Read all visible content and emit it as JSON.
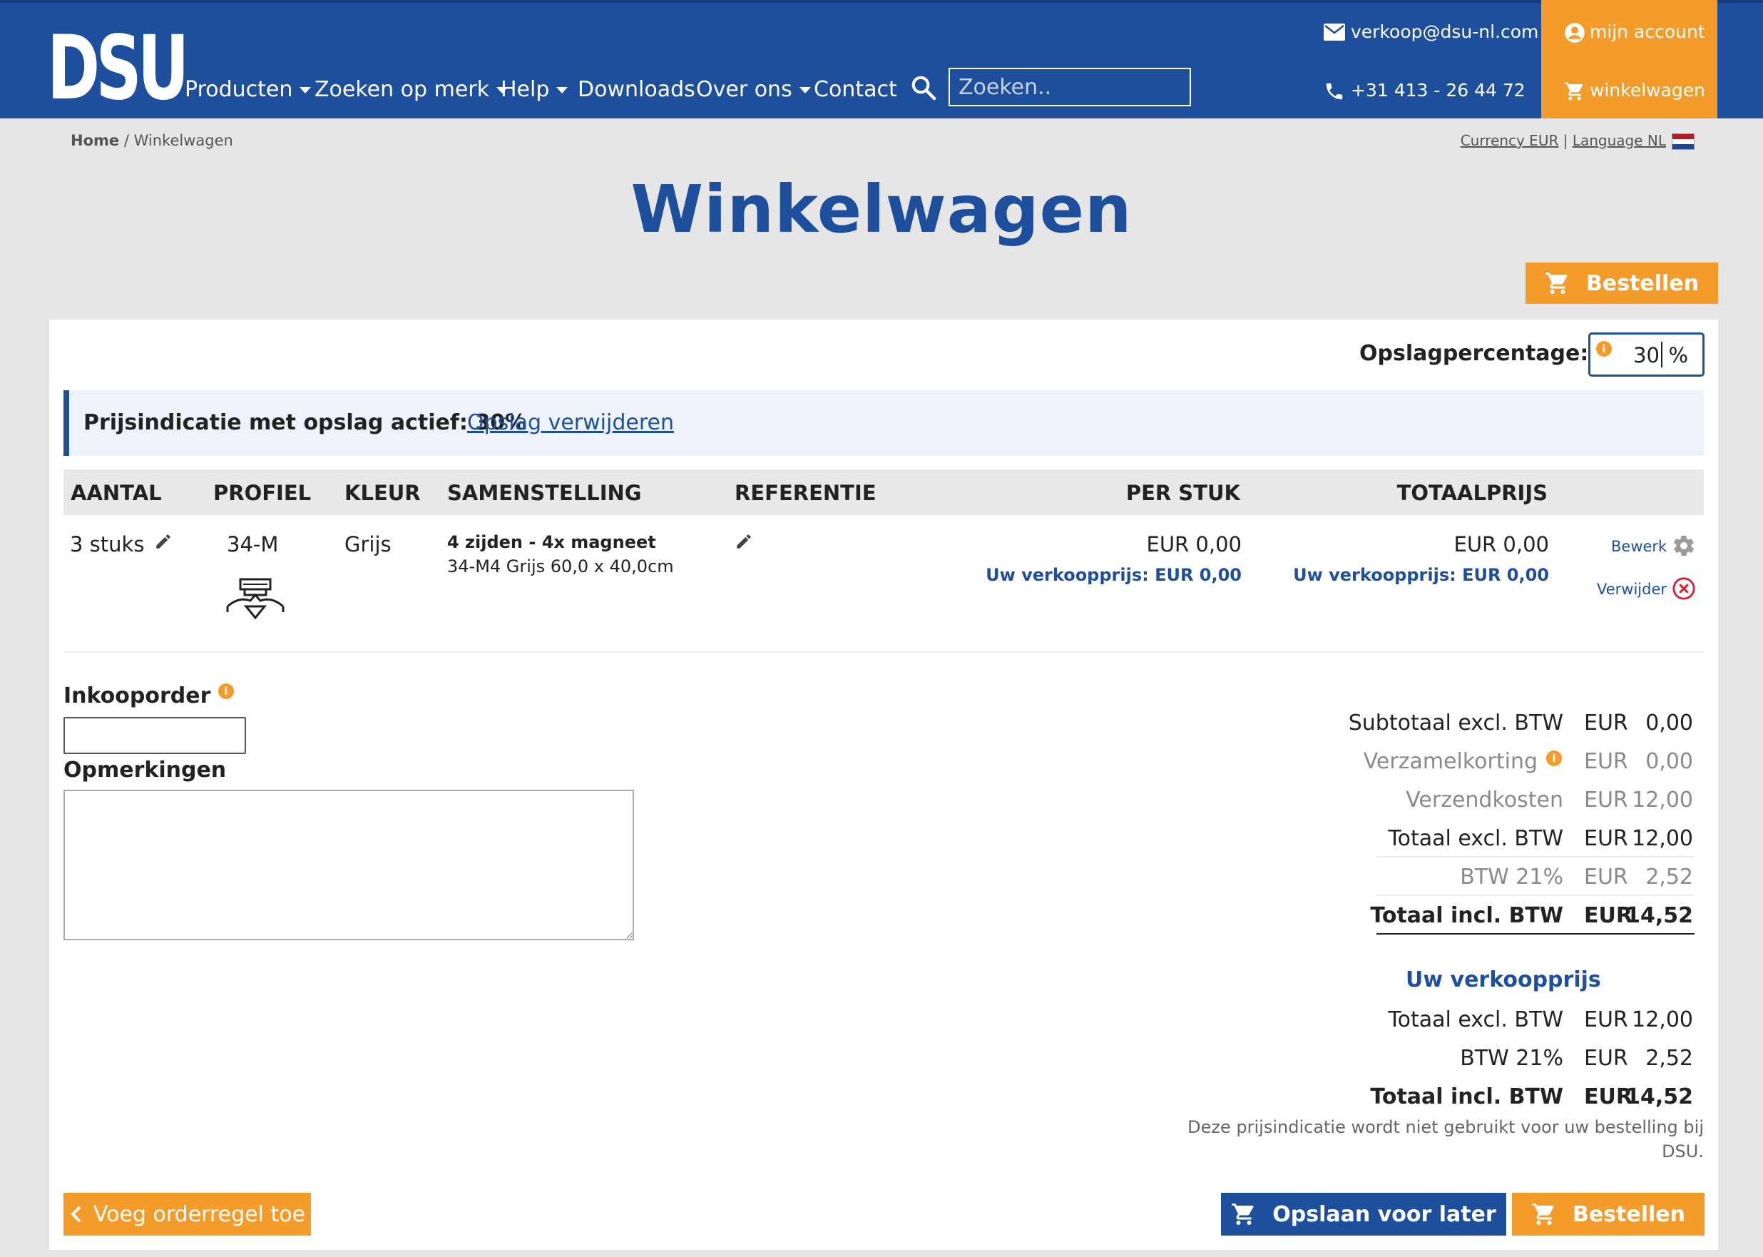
{
  "header": {
    "logo": "DSU",
    "nav": [
      "Producten",
      "Zoeken op merk",
      "Help",
      "Downloads",
      "Over ons",
      "Contact"
    ],
    "search_placeholder": "Zoeken..",
    "email": "verkoop@dsu-nl.com",
    "phone": "+31 413 - 26 44 72",
    "account_label": "mijn account",
    "cart_label": "winkelwagen",
    "colors": {
      "primary": "#1e4f9c",
      "accent": "#f39c2b"
    }
  },
  "breadcrumb": {
    "home": "Home",
    "separator": "/",
    "current": "Winkelwagen"
  },
  "locale": {
    "currency": "Currency EUR",
    "separator": "|",
    "language": "Language NL"
  },
  "page_title": "Winkelwagen",
  "order_button_label": "Bestellen",
  "markup": {
    "label": "Opslagpercentage:",
    "value": "30",
    "unit": "%"
  },
  "notice": {
    "text": "Prijsindicatie met opslag actief: 30%",
    "link": "Opslag verwijderen"
  },
  "table": {
    "headers": [
      "AANTAL",
      "PROFIEL",
      "KLEUR",
      "SAMENSTELLING",
      "REFERENTIE",
      "PER STUK",
      "TOTAALPRIJS"
    ],
    "rows": [
      {
        "quantity": "3 stuks",
        "profile": "34-M",
        "color": "Grijs",
        "composition_title": "4 zijden - 4x magneet",
        "composition_detail": "34-M4 Grijs 60,0 x 40,0cm",
        "price_each": "EUR 0,00",
        "price_each_sale": "Uw verkoopprijs: EUR 0,00",
        "total": "EUR 0,00",
        "total_sale": "Uw verkoopprijs: EUR 0,00",
        "edit_label": "Bewerk",
        "remove_label": "Verwijder"
      }
    ]
  },
  "form": {
    "po_label": "Inkooporder",
    "remarks_label": "Opmerkingen"
  },
  "totals": {
    "rows": [
      {
        "label": "Subtotaal excl. BTW",
        "currency": "EUR",
        "value": "0,00"
      },
      {
        "label": "Verzamelkorting",
        "currency": "EUR",
        "value": "0,00"
      },
      {
        "label": "Verzendkosten",
        "currency": "EUR",
        "value": "12,00"
      },
      {
        "label": "Totaal excl. BTW",
        "currency": "EUR",
        "value": "12,00"
      },
      {
        "label": "BTW 21%",
        "currency": "EUR",
        "value": "2,52"
      },
      {
        "label": "Totaal incl. BTW",
        "currency": "EUR",
        "value": "14,52"
      }
    ],
    "sale_title": "Uw verkoopprijs",
    "sale_rows": [
      {
        "label": "Totaal excl. BTW",
        "currency": "EUR",
        "value": "12,00"
      },
      {
        "label": "BTW 21%",
        "currency": "EUR",
        "value": "2,52"
      },
      {
        "label": "Totaal incl. BTW",
        "currency": "EUR",
        "value": "14,52"
      }
    ],
    "disclaimer": "Deze prijsindicatie wordt niet gebruikt voor uw bestelling bij DSU."
  },
  "footer_buttons": {
    "add_line": "Voeg orderregel toe",
    "save_later": "Opslaan voor later",
    "order": "Bestellen"
  }
}
